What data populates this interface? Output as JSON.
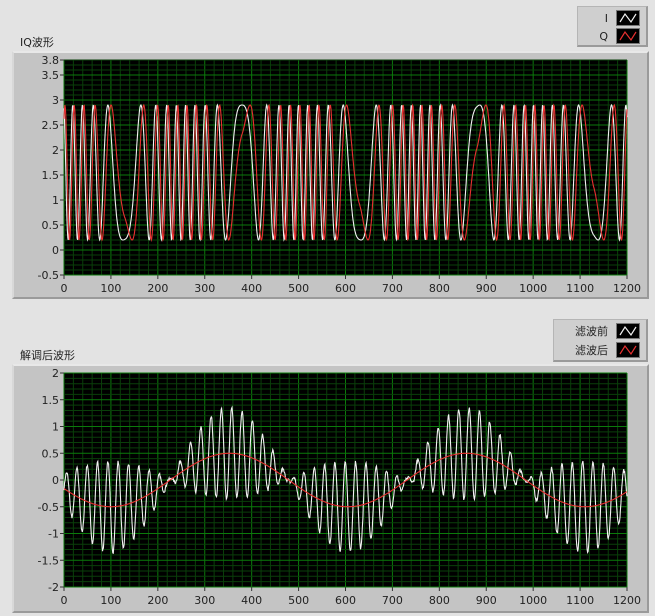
{
  "colors": {
    "plot_bg": "#000000",
    "grid_major": "#0b7a0b",
    "grid_minor": "#0a3f0a",
    "series_white": "#f2f2f2",
    "series_red": "#e83030"
  },
  "chart_data": [
    {
      "type": "line",
      "title": "IQ波形",
      "legend": {
        "placement": "top-right",
        "entries": [
          "I",
          "Q"
        ]
      },
      "xlim": [
        0,
        1200
      ],
      "ylim": [
        -0.5,
        3.8
      ],
      "x_ticks": [
        "0",
        "100",
        "200",
        "300",
        "400",
        "500",
        "600",
        "700",
        "800",
        "900",
        "1000",
        "1100",
        "1200"
      ],
      "y_ticks": [
        "3.8",
        "3.5",
        "3",
        "2.5",
        "2",
        "1.5",
        "1",
        "0.5",
        "0",
        "-0.5"
      ],
      "grid": true,
      "model": {
        "offset": 1.55,
        "amplitude": 1.35,
        "base_freq": 0.004,
        "dev_freq": 0.047,
        "slow_points": [
          130,
          380,
          630,
          880,
          1130
        ]
      },
      "series": [
        {
          "name": "I",
          "color": "#f2f2f2",
          "form": "offset+amplitude*cos(phase)"
        },
        {
          "name": "Q",
          "color": "#e83030",
          "form": "offset+amplitude*sin(phase)"
        }
      ]
    },
    {
      "type": "line",
      "title": "解调后波形",
      "legend": {
        "placement": "top-right",
        "entries": [
          "滤波前",
          "滤波后"
        ]
      },
      "xlim": [
        0,
        1200
      ],
      "ylim": [
        -2,
        2
      ],
      "x_ticks": [
        "0",
        "100",
        "200",
        "300",
        "400",
        "500",
        "600",
        "700",
        "800",
        "900",
        "1000",
        "1100",
        "1200"
      ],
      "y_ticks": [
        "2",
        "1.5",
        "1",
        "0.5",
        "0",
        "-0.5",
        "-1",
        "-1.5",
        "-2"
      ],
      "grid": true,
      "series": [
        {
          "name": "滤波前",
          "color": "#f2f2f2",
          "model": {
            "carrier_period": 22,
            "carrier_amplitude": 0.85,
            "noise": 0.06
          }
        },
        {
          "name": "滤波后",
          "color": "#e83030",
          "x": [
            0,
            50,
            100,
            150,
            200,
            250,
            300,
            350,
            400,
            450,
            500,
            550,
            600,
            650,
            700,
            750,
            800,
            850,
            900,
            950,
            1000,
            1050,
            1100,
            1150,
            1200
          ],
          "values": [
            -0.16,
            -0.41,
            -0.5,
            -0.4,
            -0.16,
            0.14,
            0.39,
            0.5,
            0.41,
            0.18,
            -0.11,
            -0.38,
            -0.5,
            -0.42,
            -0.2,
            0.09,
            0.36,
            0.5,
            0.43,
            0.22,
            -0.07,
            -0.34,
            -0.49,
            -0.44,
            -0.24
          ]
        }
      ]
    }
  ]
}
